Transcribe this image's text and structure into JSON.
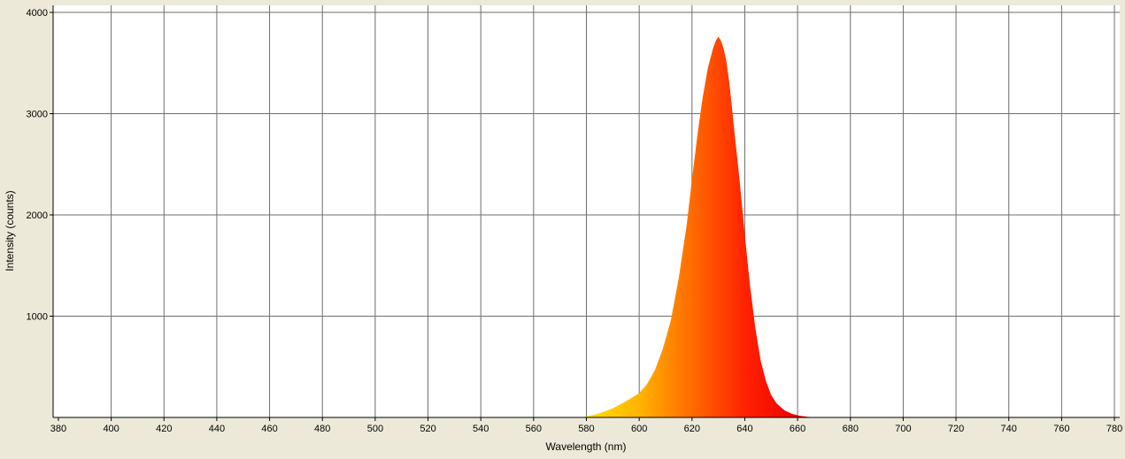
{
  "chart_data": {
    "type": "area",
    "title": "",
    "xlabel": "Wavelength (nm)",
    "ylabel": "Intensity (counts)",
    "xlim": [
      378,
      782
    ],
    "ylim": [
      0,
      4070
    ],
    "x_ticks": [
      380,
      400,
      420,
      440,
      460,
      480,
      500,
      520,
      540,
      560,
      580,
      600,
      620,
      640,
      660,
      680,
      700,
      720,
      740,
      760,
      780
    ],
    "y_ticks": [
      1000,
      2000,
      3000,
      4000
    ],
    "grid": true,
    "legend": "none",
    "fill_gradient": {
      "wavelengths": [
        580,
        600,
        620,
        640,
        660
      ],
      "colors": [
        "#ffe000",
        "#ffb400",
        "#ff6a00",
        "#ff2200",
        "#ee0000"
      ]
    },
    "x": [
      578,
      580,
      585,
      590,
      595,
      600,
      603,
      606,
      609,
      612,
      615,
      618,
      620,
      622,
      624,
      626,
      628,
      629,
      630,
      631,
      632,
      633,
      634,
      635,
      636,
      638,
      640,
      642,
      644,
      646,
      648,
      650,
      652,
      655,
      658,
      661,
      664,
      668
    ],
    "y": [
      0,
      10,
      40,
      90,
      160,
      240,
      330,
      470,
      680,
      960,
      1380,
      1900,
      2350,
      2780,
      3150,
      3450,
      3650,
      3720,
      3760,
      3720,
      3640,
      3520,
      3330,
      3100,
      2840,
      2350,
      1800,
      1300,
      880,
      560,
      360,
      220,
      140,
      70,
      35,
      15,
      5,
      0
    ]
  }
}
